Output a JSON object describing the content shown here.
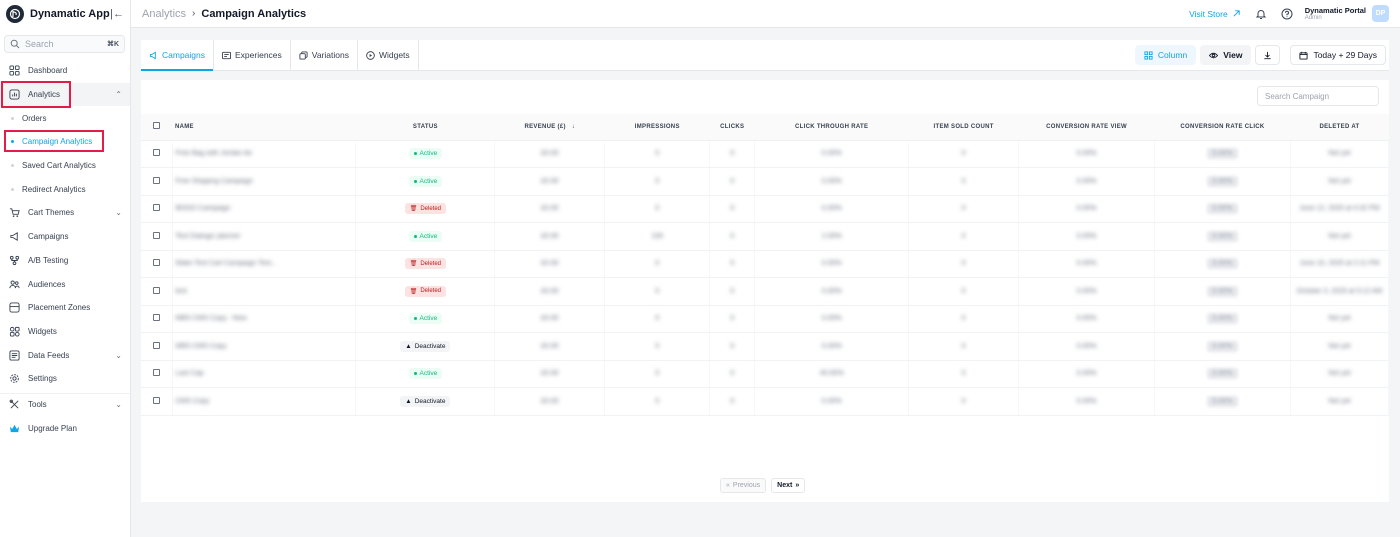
{
  "app": {
    "name": "Dynamatic App"
  },
  "sidebar": {
    "search_placeholder": "Search",
    "search_shortcut": "⌘K",
    "items": [
      {
        "label": "Dashboard"
      },
      {
        "label": "Analytics"
      },
      {
        "label": "Orders"
      },
      {
        "label": "Campaign Analytics"
      },
      {
        "label": "Saved Cart Analytics"
      },
      {
        "label": "Redirect Analytics"
      },
      {
        "label": "Cart Themes"
      },
      {
        "label": "Campaigns"
      },
      {
        "label": "A/B Testing"
      },
      {
        "label": "Audiences"
      },
      {
        "label": "Placement Zones"
      },
      {
        "label": "Widgets"
      },
      {
        "label": "Data Feeds"
      },
      {
        "label": "Settings"
      },
      {
        "label": "Tools"
      },
      {
        "label": "Upgrade Plan"
      }
    ]
  },
  "header": {
    "breadcrumb_parent": "Analytics",
    "breadcrumb_sep": "›",
    "title": "Campaign Analytics",
    "visit_store": "Visit Store",
    "user_name": "Dynamatic Portal",
    "user_role": "Admin",
    "avatar_initials": "DP"
  },
  "tabs": [
    {
      "label": "Campaigns"
    },
    {
      "label": "Experiences"
    },
    {
      "label": "Variations"
    },
    {
      "label": "Widgets"
    }
  ],
  "toolbar": {
    "column_label": "Column",
    "view_label": "View",
    "date_range": "Today + 29 Days"
  },
  "table": {
    "search_placeholder": "Search Campaign",
    "columns": {
      "name": "NAME",
      "status": "STATUS",
      "revenue": "REVENUE (£)",
      "impressions": "IMPRESSIONS",
      "clicks": "CLICKS",
      "ctr": "CLICK THROUGH RATE",
      "item_sold": "ITEM SOLD COUNT",
      "cr_view": "CONVERSION RATE VIEW",
      "cr_click": "CONVERSION RATE CLICK",
      "deleted_at": "DELETED AT"
    },
    "rows": [
      {
        "name": "Free Bag with Jordan Air",
        "status": "Active",
        "revenue": "£0.00",
        "impressions": "0",
        "clicks": "0",
        "ctr": "0.00%",
        "item_sold": "0",
        "cr_view": "0.00%",
        "cr_click": "0.00%",
        "deleted_at": "Not yet"
      },
      {
        "name": "Free Shipping Campaign",
        "status": "Active",
        "revenue": "£0.00",
        "impressions": "0",
        "clicks": "0",
        "ctr": "0.00%",
        "item_sold": "0",
        "cr_view": "0.00%",
        "cr_click": "0.00%",
        "deleted_at": "Not yet"
      },
      {
        "name": "BOGO Campaign",
        "status": "Deleted",
        "revenue": "£0.00",
        "impressions": "0",
        "clicks": "0",
        "ctr": "0.00%",
        "item_sold": "0",
        "cr_view": "0.00%",
        "cr_click": "0.00%",
        "deleted_at": "June 12, 2025 at 4:32 PM"
      },
      {
        "name": "Test Dialogic planner",
        "status": "Active",
        "revenue": "£0.00",
        "impressions": "100",
        "clicks": "0",
        "ctr": "2.00%",
        "item_sold": "0",
        "cr_view": "0.00%",
        "cr_click": "0.00%",
        "deleted_at": "Not yet"
      },
      {
        "name": "Make Test Cart Campaign Test...",
        "status": "Deleted",
        "revenue": "£0.00",
        "impressions": "0",
        "clicks": "0",
        "ctr": "0.00%",
        "item_sold": "0",
        "cr_view": "0.00%",
        "cr_click": "0.00%",
        "deleted_at": "June 10, 2025 at 2:11 PM"
      },
      {
        "name": "test",
        "status": "Deleted",
        "revenue": "£0.00",
        "impressions": "0",
        "clicks": "0",
        "ctr": "0.00%",
        "item_sold": "0",
        "cr_view": "0.00%",
        "cr_click": "0.00%",
        "deleted_at": "October 3, 2025 at 5:12 AM"
      },
      {
        "name": "MBS CMS Copy - New",
        "status": "Active",
        "revenue": "£0.00",
        "impressions": "0",
        "clicks": "0",
        "ctr": "0.00%",
        "item_sold": "0",
        "cr_view": "0.00%",
        "cr_click": "0.00%",
        "deleted_at": "Not yet"
      },
      {
        "name": "MBS CMS Copy",
        "status": "Deactivate",
        "revenue": "£0.00",
        "impressions": "0",
        "clicks": "0",
        "ctr": "0.00%",
        "item_sold": "0",
        "cr_view": "0.00%",
        "cr_click": "0.00%",
        "deleted_at": "Not yet"
      },
      {
        "name": "Last Cap",
        "status": "Active",
        "revenue": "£0.00",
        "impressions": "0",
        "clicks": "0",
        "ctr": "40.00%",
        "item_sold": "0",
        "cr_view": "0.00%",
        "cr_click": "0.00%",
        "deleted_at": "Not yet"
      },
      {
        "name": "CMS Copy",
        "status": "Deactivate",
        "revenue": "£0.00",
        "impressions": "0",
        "clicks": "0",
        "ctr": "0.00%",
        "item_sold": "0",
        "cr_view": "0.00%",
        "cr_click": "0.00%",
        "deleted_at": "Not yet"
      }
    ]
  },
  "pagination": {
    "previous": "Previous",
    "next": "Next"
  },
  "colors": {
    "accent": "#0ea5e9",
    "highlight": "#e11d48",
    "active": "#10b981",
    "deleted": "#b91c1c"
  },
  "icons": {
    "dashboard": "grid-icon",
    "analytics": "chart-icon",
    "cart_themes": "cart-icon",
    "campaigns": "megaphone-icon",
    "ab_testing": "flask-icon",
    "audiences": "users-icon",
    "placement_zones": "layout-icon",
    "widgets": "widget-icon",
    "data_feeds": "feed-icon",
    "settings": "gear-icon",
    "tools": "tools-icon",
    "upgrade": "crown-icon"
  }
}
